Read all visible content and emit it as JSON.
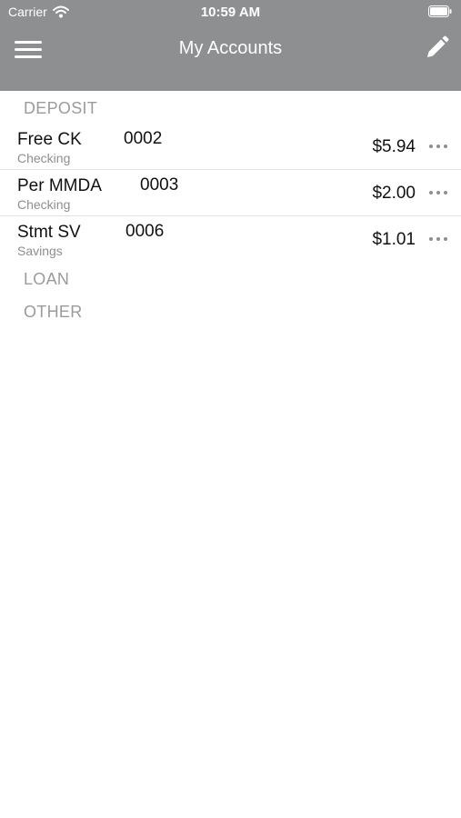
{
  "status_bar": {
    "carrier": "Carrier",
    "time": "10:59 AM"
  },
  "nav": {
    "title": "My Accounts",
    "menu_icon": "hamburger-menu-icon",
    "edit_icon": "pencil-icon"
  },
  "sections": {
    "deposit": "DEPOSIT",
    "loan": "LOAN",
    "other": "OTHER"
  },
  "accounts": [
    {
      "name": "Free CK",
      "number": "0002",
      "type": "Checking",
      "balance": "$5.94"
    },
    {
      "name": "Per MMDA",
      "number": "0003",
      "type": "Checking",
      "balance": "$2.00"
    },
    {
      "name": "Stmt SV",
      "number": "0006",
      "type": "Savings",
      "balance": "$1.01"
    }
  ],
  "colors": {
    "header_bg": "#8e8f91",
    "section_text": "#9b9b9b",
    "secondary_text": "#8e8e8e"
  }
}
